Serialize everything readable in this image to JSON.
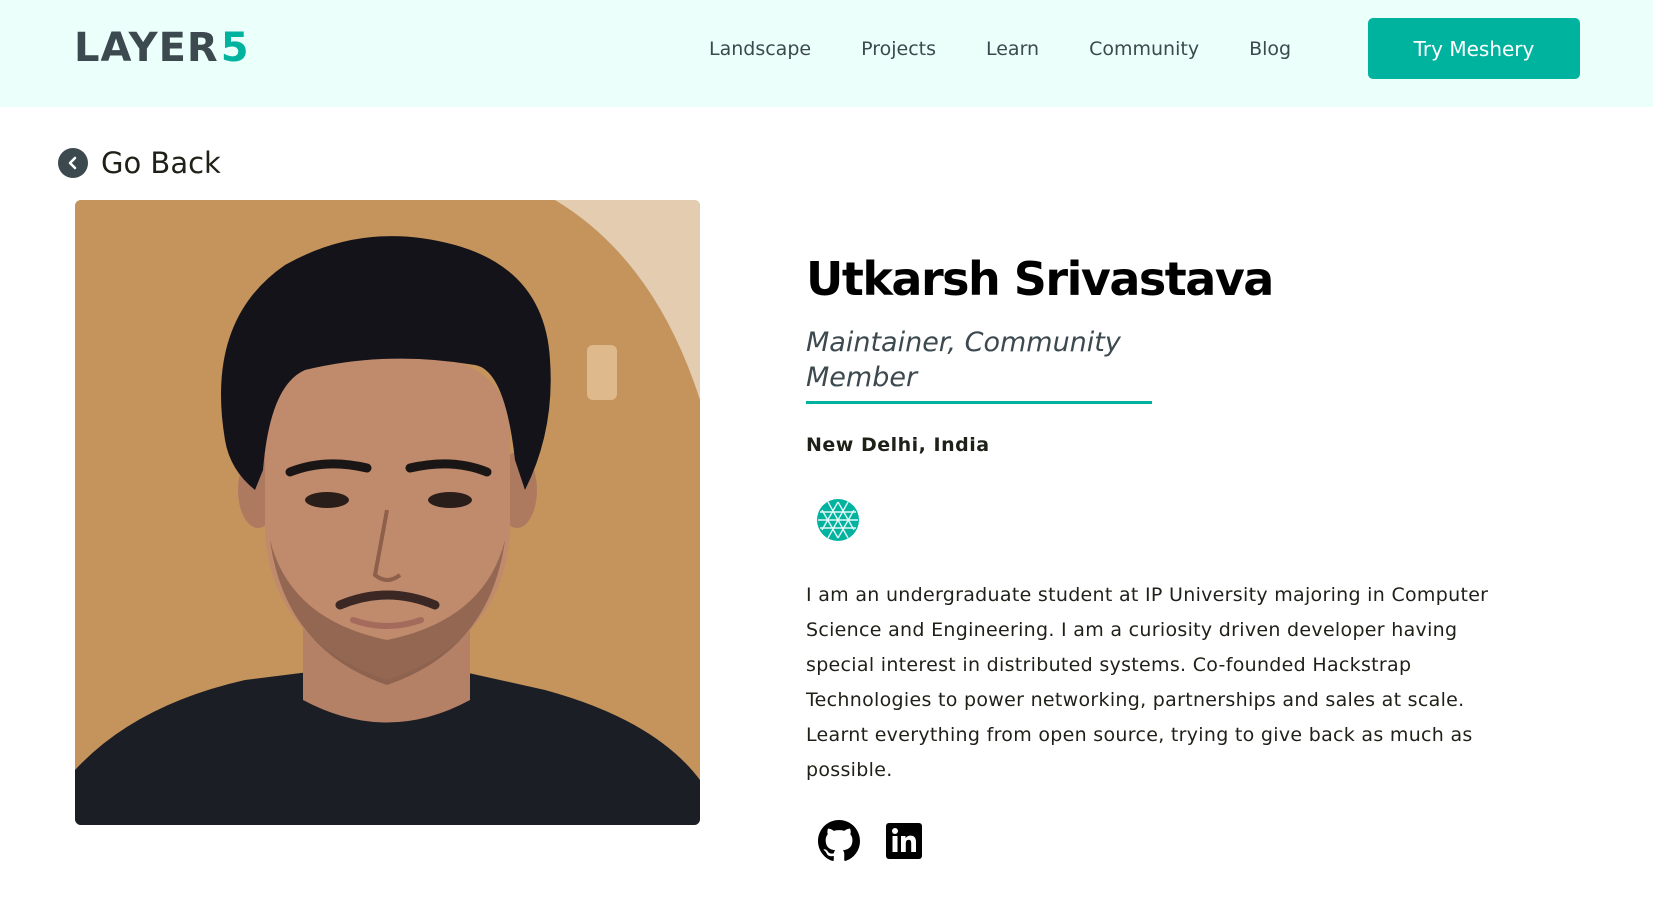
{
  "header": {
    "logo": {
      "text": "LAYER",
      "accent": "5"
    },
    "nav": [
      "Landscape",
      "Projects",
      "Learn",
      "Community",
      "Blog"
    ],
    "cta_label": "Try Meshery"
  },
  "go_back": {
    "label": "Go Back",
    "icon": "chevron-left-icon"
  },
  "profile": {
    "photo_alt": "Utkarsh Srivastava",
    "name": "Utkarsh Srivastava",
    "role": "Maintainer, Community Member",
    "location": "New Delhi, India",
    "badge_icon": "meshery-badge-icon",
    "bio": "I am an undergraduate student at IP University majoring in Computer Science and Engineering. I am a curiosity driven developer having special interest in distributed systems. Co-founded Hackstrap Technologies to power networking, partnerships and sales at scale. Learnt everything from open source, trying to give back as much as possible.",
    "social": [
      {
        "icon": "github-icon"
      },
      {
        "icon": "linkedin-icon"
      }
    ]
  },
  "colors": {
    "accent": "#00b39f",
    "header_bg": "#ebfffb",
    "text_dark": "#3c494f"
  }
}
